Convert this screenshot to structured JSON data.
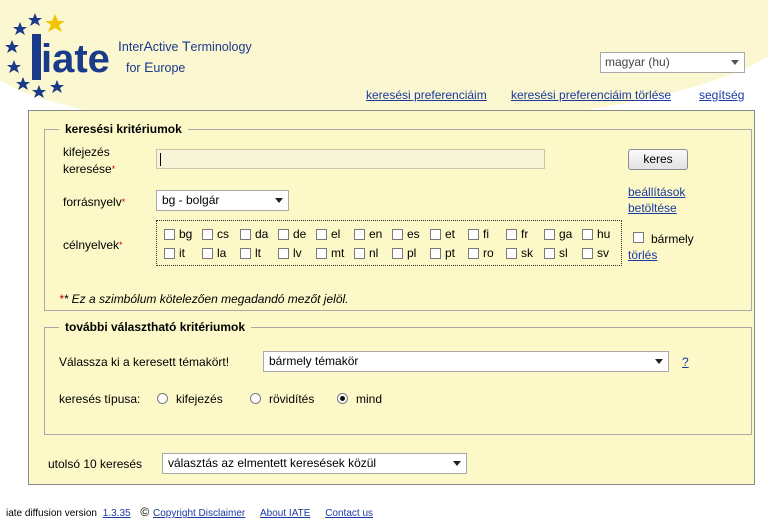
{
  "header": {
    "logo_text": "iate",
    "title_line1": [
      "Inter",
      "Active ",
      "Terminology"
    ],
    "title_line2": "for Europe",
    "ui_language": "magyar (hu)",
    "links": [
      "keresési preferenciáim",
      "keresési preferenciáim törlése",
      "segítség"
    ]
  },
  "search": {
    "legend": "keresési kritériumok",
    "term_label_1": "kifejezés",
    "term_label_2": "keresése",
    "search_value": "",
    "search_button": "keres",
    "source_label": "forrásnyelv",
    "source_value": "bg - bolgár",
    "load_settings_1": "beállítások",
    "load_settings_2": "betöltése",
    "target_label": "célnyelvek",
    "target_languages_row1": [
      "bg",
      "cs",
      "da",
      "de",
      "el",
      "en",
      "es",
      "et",
      "fi",
      "fr",
      "ga",
      "hu"
    ],
    "target_languages_row2": [
      "it",
      "la",
      "lt",
      "lv",
      "mt",
      "nl",
      "pl",
      "pt",
      "ro",
      "sk",
      "sl",
      "sv"
    ],
    "any_label": "bármely",
    "clear_link": "törlés",
    "required_note": "* Ez a szimbólum kötelezően megadandó mezőt jelöl."
  },
  "optional": {
    "legend": "további választható kritériumok",
    "domain_label": "Válassza ki a keresett témakört!",
    "domain_value": "bármely témakör",
    "help_link": "?",
    "type_label": "keresés típusa:",
    "type_options": [
      {
        "label": "kifejezés",
        "selected": false
      },
      {
        "label": "rövidítés",
        "selected": false
      },
      {
        "label": "mind",
        "selected": true
      }
    ]
  },
  "history": {
    "label": "utolsó 10 keresés",
    "value": "választás az elmentett keresések közül"
  },
  "footer": {
    "version_label": "iate diffusion version",
    "version": "1.3.35",
    "copyright_symbol": "©",
    "links": [
      "Copyright Disclaimer",
      "About IATE",
      "Contact us"
    ]
  },
  "colors": {
    "panel_bg": "#fcf8c8",
    "link": "#1a3aa0",
    "logo_blue": "#1a3a8a",
    "star_yellow": "#f2c400",
    "required": "#cc0000"
  }
}
